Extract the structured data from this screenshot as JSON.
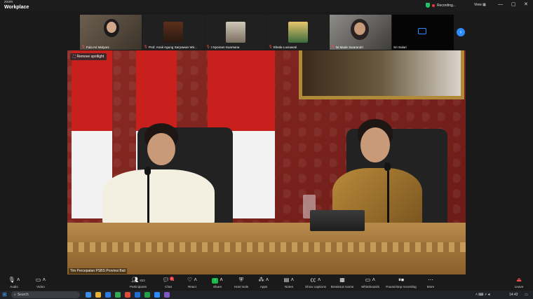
{
  "app": {
    "brand_top": "zoom",
    "brand_bottom": "Workplace",
    "recording_label": "Recording...",
    "view_label": "View"
  },
  "gallery": [
    {
      "name": "Fula Ari Mulyani"
    },
    {
      "name": "Prof. Anak Agung Saryawan Wir..."
    },
    {
      "name": "I Nyoman Suarsana"
    },
    {
      "name": "Elinda Luviawati"
    },
    {
      "name": "Ni Made Swarandri"
    },
    {
      "name": "Sri Sulari"
    }
  ],
  "video": {
    "spotlight_label": "Remove spotlight",
    "speaker_name": "Tim Percepatan PSBS Provinsi Bali"
  },
  "toolbar": {
    "audio": "Audio",
    "video": "Video",
    "participants": "Participants",
    "participants_count": "823",
    "chat": "Chat",
    "chat_badge": "1",
    "react": "React",
    "share": "Share",
    "host_tools": "Host tools",
    "apps": "Apps",
    "notes": "Notes",
    "show_captions": "Show captions",
    "breakout_rooms": "Breakout rooms",
    "whiteboards": "Whiteboards",
    "recording": "Pause/stop recording",
    "more": "More",
    "leave": "Leave"
  },
  "taskbar": {
    "search_placeholder": "Search",
    "time": "14:42"
  },
  "colors": {
    "accent": "#2d8cff",
    "share_green": "#19b84a",
    "alert_red": "#e83b3b"
  }
}
